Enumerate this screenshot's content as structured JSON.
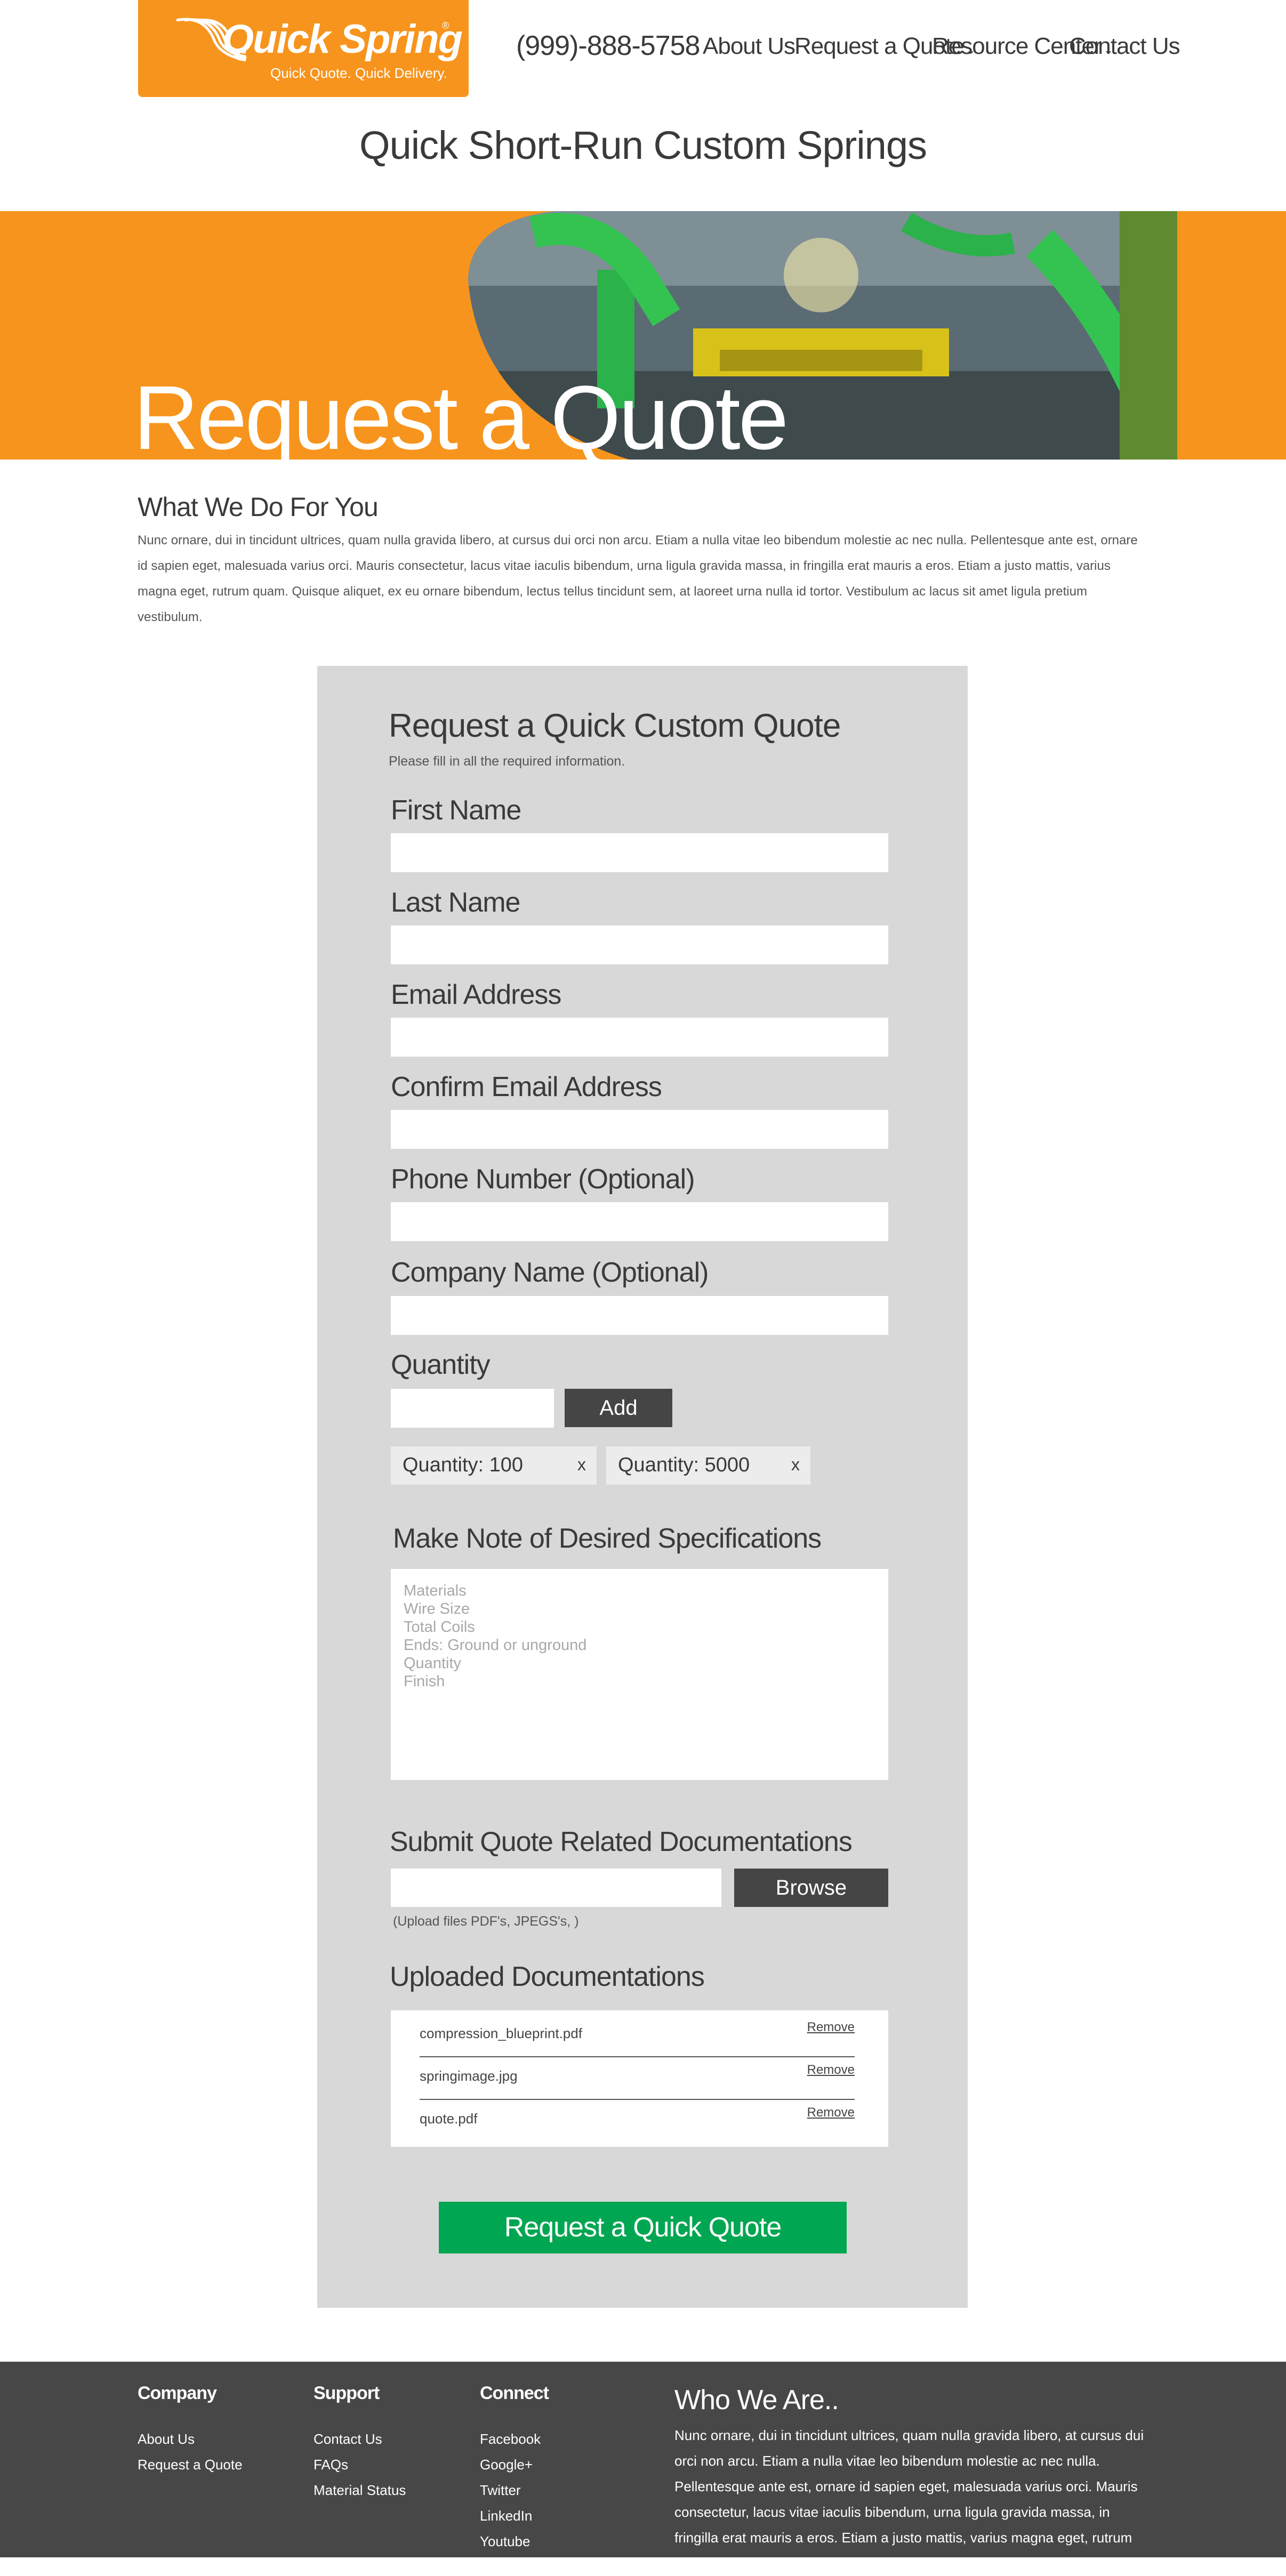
{
  "header": {
    "logo_brand": "Quick Spring",
    "logo_reg": "®",
    "logo_tagline": "Quick Quote. Quick Delivery.",
    "phone": "(999)-888-5758",
    "nav": [
      "About Us",
      "Request a Quote",
      "Resource Center",
      "Contact Us"
    ]
  },
  "page_title": "Quick Short-Run Custom Springs",
  "hero": {
    "title": "Request a Quote"
  },
  "intro": {
    "heading": "What We Do For You",
    "body": "Nunc ornare, dui in tincidunt ultrices, quam nulla gravida libero, at cursus dui orci non arcu. Etiam a nulla vitae leo bibendum molestie ac nec nulla. Pellentesque ante est, ornare id sapien eget, malesuada varius orci. Mauris consectetur, lacus vitae iaculis bibendum, urna ligula gravida massa, in fringilla erat mauris a eros. Etiam a justo mattis, varius magna eget, rutrum quam. Quisque aliquet, ex eu ornare bibendum, lectus tellus tincidunt sem, at laoreet urna nulla id tortor. Vestibulum ac lacus sit amet ligula pretium vestibulum."
  },
  "form": {
    "title": "Request a Quick Custom Quote",
    "subtitle": "Please fill in all the required information.",
    "fields": {
      "first_name": "First Name",
      "last_name": "Last Name",
      "email": "Email Address",
      "confirm_email": "Confirm Email Address",
      "phone": "Phone Number (Optional)",
      "company": "Company Name (Optional)",
      "quantity": "Quantity"
    },
    "values": {
      "first_name": "",
      "last_name": "",
      "email": "",
      "confirm_email": "",
      "phone": "",
      "company": "",
      "quantity": "",
      "upload": ""
    },
    "add_label": "Add",
    "quantity_tags": [
      {
        "label": "Quantity: 100",
        "remove": "x"
      },
      {
        "label": "Quantity: 5000",
        "remove": "x"
      }
    ],
    "specs_label": "Make Note of Desired Specifications",
    "specs_placeholder": "Materials\nWire Size\nTotal Coils\nEnds: Ground or unground\nQuantity\nFinish",
    "upload_label": "Submit Quote Related Documentations",
    "browse_label": "Browse",
    "upload_hint": "(Upload files PDF's, JPEGS's, )",
    "uploaded_label": "Uploaded Documentations",
    "documents": [
      {
        "name": "compression_blueprint.pdf",
        "action": "Remove"
      },
      {
        "name": "springimage.jpg",
        "action": "Remove"
      },
      {
        "name": "quote.pdf",
        "action": "Remove"
      }
    ],
    "submit_label": "Request a Quick Quote"
  },
  "footer": {
    "company": {
      "heading": "Company",
      "links": [
        "About Us",
        "Request a Quote"
      ]
    },
    "support": {
      "heading": "Support",
      "links": [
        "Contact Us",
        "FAQs",
        "Material Status"
      ]
    },
    "connect": {
      "heading": "Connect",
      "links": [
        "Facebook",
        "Google+",
        "Twitter",
        "LinkedIn",
        "Youtube"
      ]
    },
    "who": {
      "heading": "Who We Are..",
      "body": "Nunc ornare, dui in tincidunt ultrices, quam nulla gravida libero, at cursus dui orci non arcu. Etiam a nulla vitae leo bibendum molestie ac nec nulla. Pellentesque ante est, ornare id sapien eget, malesuada varius orci. Mauris consectetur, lacus vitae iaculis bibendum, urna ligula gravida massa, in fringilla erat mauris a eros. Etiam a justo mattis, varius magna eget, rutrum quam. Quisque"
    }
  },
  "colors": {
    "brand_orange": "#f7941d",
    "panel_gray": "#d8d8d8",
    "dark_button": "#454545",
    "submit_green": "#00a651",
    "footer_bg": "#474747"
  }
}
